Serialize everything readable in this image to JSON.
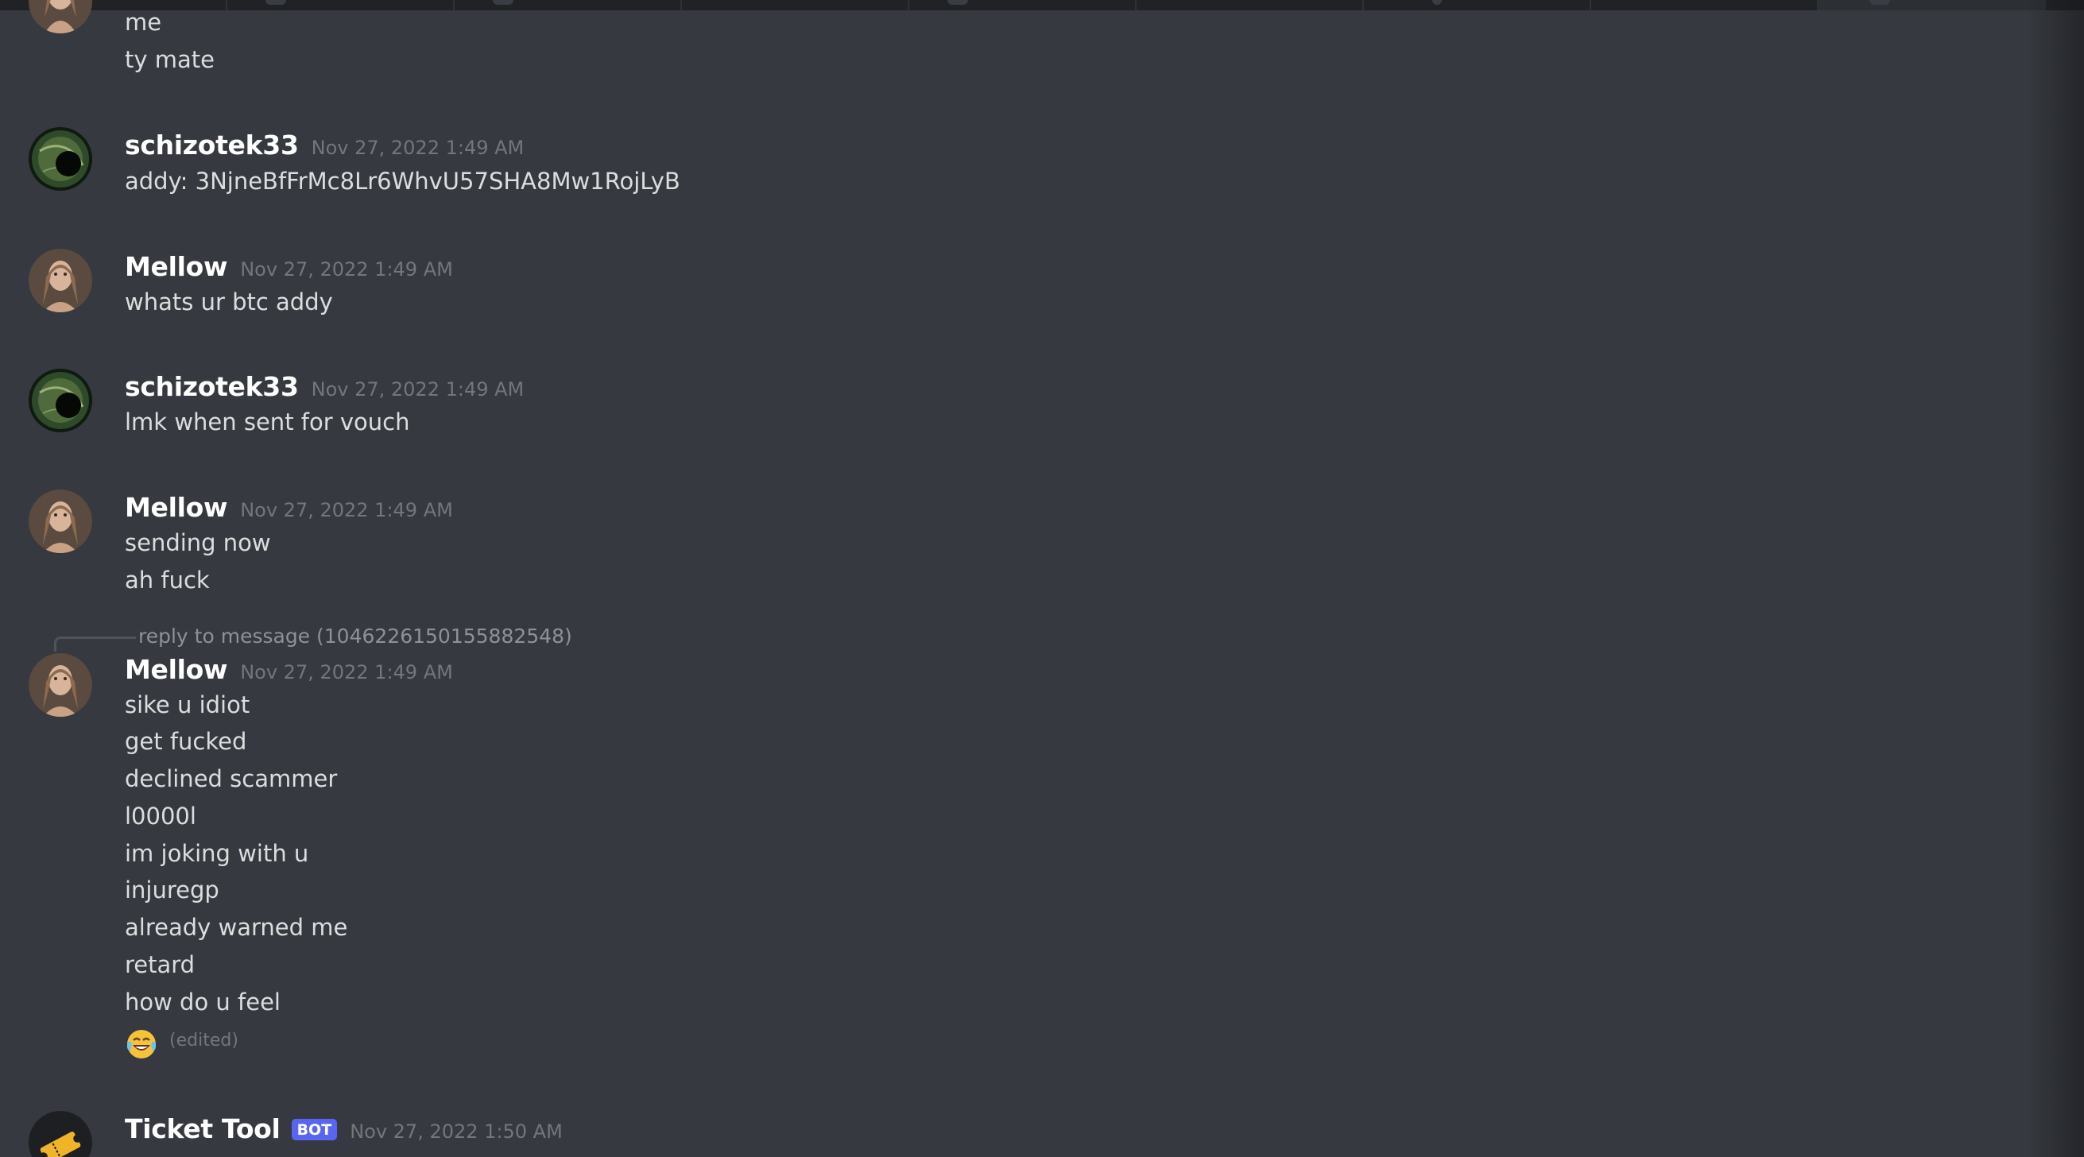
{
  "colors": {
    "background": "#36393f",
    "tabbar": "#202225",
    "username": "#ffffff",
    "timestamp": "#72767d",
    "message_text": "#dcddde",
    "bot_badge": "#5865f2"
  },
  "messages": [
    {
      "lines": [
        "me",
        "ty mate"
      ]
    },
    {
      "author": "schizotek33",
      "avatar_icon": "dark-green-orb-avatar",
      "timestamp": "Nov 27, 2022 1:49 AM",
      "lines": [
        "addy: 3NjneBfFrMc8Lr6WhvU57SHA8Mw1RojLyB"
      ]
    },
    {
      "author": "Mellow",
      "avatar_icon": "portrait-avatar",
      "timestamp": "Nov 27, 2022 1:49 AM",
      "lines": [
        "whats ur btc addy"
      ]
    },
    {
      "author": "schizotek33",
      "avatar_icon": "dark-green-orb-avatar",
      "timestamp": "Nov 27, 2022 1:49 AM",
      "lines": [
        "lmk when sent for vouch"
      ]
    },
    {
      "author": "Mellow",
      "avatar_icon": "portrait-avatar",
      "timestamp": "Nov 27, 2022 1:49 AM",
      "lines": [
        "sending now",
        "ah fuck"
      ]
    },
    {
      "reply_to": "reply to message (1046226150155882548)",
      "author": "Mellow",
      "avatar_icon": "portrait-avatar",
      "timestamp": "Nov 27, 2022 1:49 AM",
      "lines": [
        "sike u idiot",
        "get fucked",
        "declined scammer",
        "l0000l",
        "im joking with u",
        "injuregp",
        "already warned me",
        "retard",
        "how do u feel"
      ],
      "last_line_emoji": "face-with-tears-of-joy-icon",
      "edited_label": "(edited)"
    },
    {
      "author": "Ticket Tool",
      "badge": "BOT",
      "avatar_icon": "ticket-avatar",
      "timestamp": "Nov 27, 2022 1:50 AM"
    }
  ]
}
